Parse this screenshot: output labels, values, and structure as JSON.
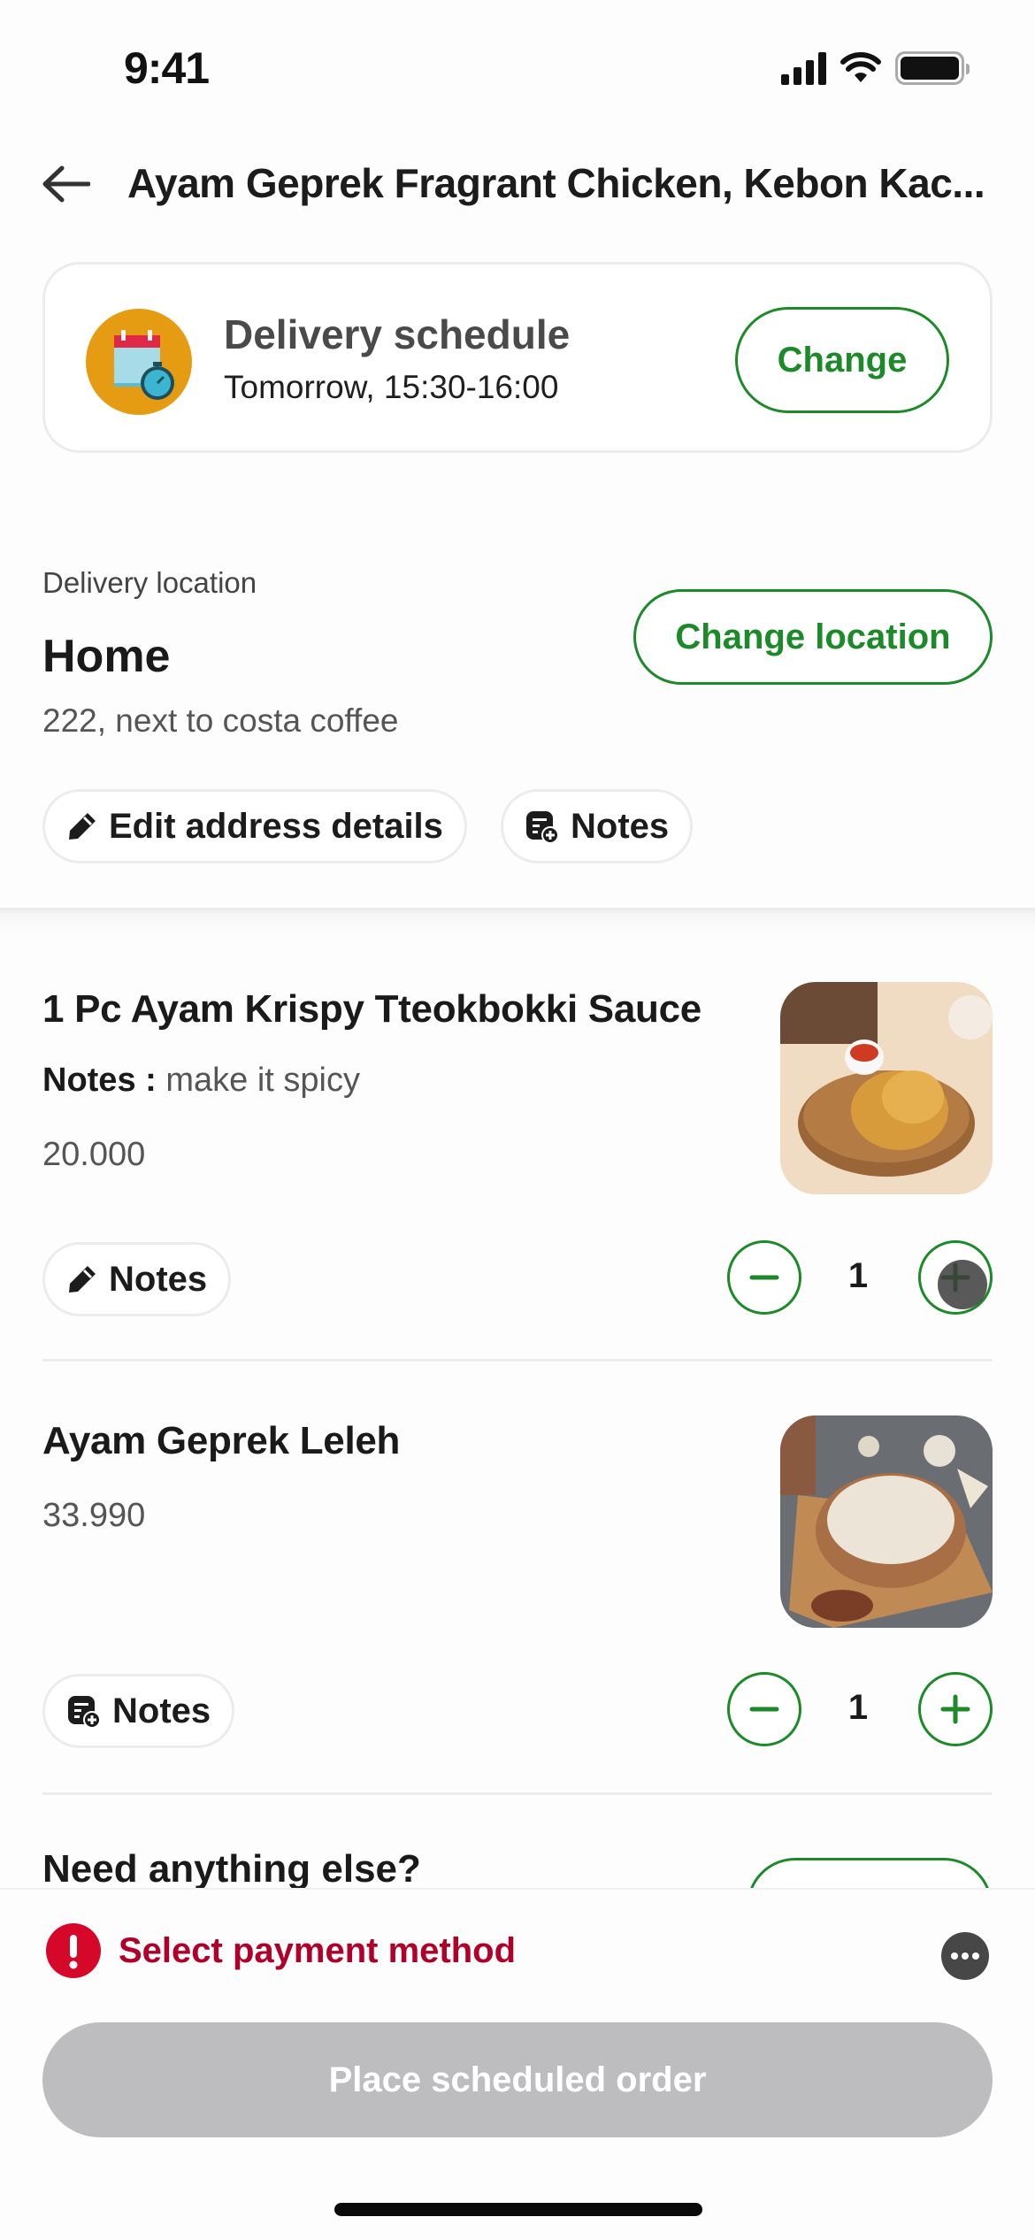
{
  "status_bar": {
    "time": "9:41",
    "signal_icon": "cellular-signal-icon",
    "wifi_icon": "wifi-icon",
    "battery_icon": "battery-icon"
  },
  "header": {
    "back_icon": "arrow-left-icon",
    "title": "Ayam Geprek Fragrant Chicken, Kebon Kac..."
  },
  "schedule": {
    "icon": "calendar-stopwatch-icon",
    "title": "Delivery schedule",
    "time": "Tomorrow, 15:30-16:00",
    "change_label": "Change"
  },
  "location": {
    "label": "Delivery location",
    "name": "Home",
    "address": "222, next to costa coffee",
    "change_label": "Change location",
    "edit_label": "Edit address details",
    "notes_label": "Notes"
  },
  "items": [
    {
      "name": "1 Pc Ayam Krispy Tteokbokki Sauce",
      "notes_prefix": "Notes :",
      "notes": "make it spicy",
      "price": "20.000",
      "notes_button": "Notes",
      "notes_icon": "pencil-icon",
      "quantity": "1",
      "image": "fried-chicken-photo"
    },
    {
      "name": "Ayam Geprek Leleh",
      "price": "33.990",
      "notes_button": "Notes",
      "notes_icon": "note-add-icon",
      "quantity": "1",
      "image": "cheese-chicken-photo"
    }
  ],
  "upsell": {
    "title": "Need anything else?"
  },
  "payment": {
    "alert_icon": "exclamation-icon",
    "text": "Select payment method",
    "more_icon": "more-horizontal-icon"
  },
  "footer": {
    "place_order_label": "Place scheduled order"
  },
  "colors": {
    "brand_green": "#1c8a28",
    "alert_red": "#d6082a",
    "disabled_gray": "#bdbcbe"
  }
}
